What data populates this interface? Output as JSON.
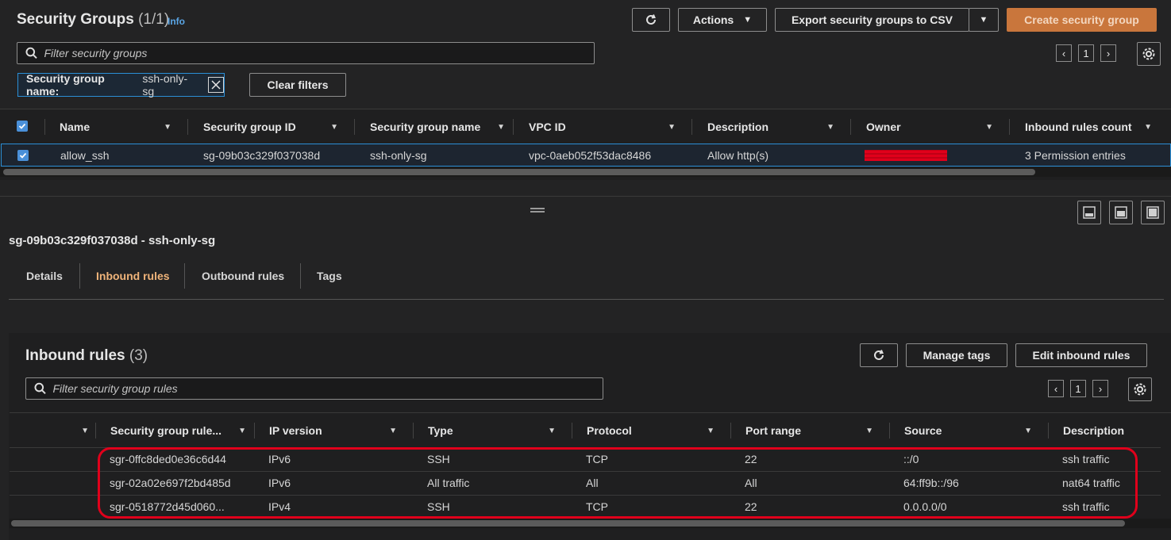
{
  "sg_panel": {
    "title": "Security Groups",
    "count": "(1/1)",
    "info": "Info",
    "actions": "Actions",
    "export": "Export security groups to CSV",
    "create": "Create security group",
    "filter_placeholder": "Filter security groups",
    "chip_label": "Security group name:",
    "chip_value": "ssh-only-sg",
    "clear_filters": "Clear filters",
    "page": "1",
    "columns": [
      "Name",
      "Security group ID",
      "Security group name",
      "VPC ID",
      "Description",
      "Owner",
      "Inbound rules count"
    ],
    "row": {
      "name": "allow_ssh",
      "id": "sg-09b03c329f037038d",
      "group_name": "ssh-only-sg",
      "vpc": "vpc-0aeb052f53dac8486",
      "description": "Allow http(s)",
      "owner": "",
      "rules_count": "3 Permission entries"
    }
  },
  "detail": {
    "heading": "sg-09b03c329f037038d - ssh-only-sg",
    "tabs": [
      "Details",
      "Inbound rules",
      "Outbound rules",
      "Tags"
    ],
    "active_tab": "Inbound rules"
  },
  "inbound": {
    "title": "Inbound rules",
    "count": "(3)",
    "manage_tags": "Manage tags",
    "edit": "Edit inbound rules",
    "filter_placeholder": "Filter security group rules",
    "page": "1",
    "columns": [
      "Security group rule...",
      "IP version",
      "Type",
      "Protocol",
      "Port range",
      "Source",
      "Description"
    ],
    "rows": [
      [
        "sgr-0ffc8ded0e36c6d44",
        "IPv6",
        "SSH",
        "TCP",
        "22",
        "::/0",
        "ssh traffic"
      ],
      [
        "sgr-02a02e697f2bd485d",
        "IPv6",
        "All traffic",
        "All",
        "All",
        "64:ff9b::/96",
        "nat64 traffic"
      ],
      [
        "sgr-0518772d45d060...",
        "IPv4",
        "SSH",
        "TCP",
        "22",
        "0.0.0.0/0",
        "ssh traffic"
      ]
    ]
  },
  "colors": {
    "accent": "#c9763c",
    "link": "#5aa6e6",
    "active_tab": "#f0b47a",
    "selection_border": "#2b8fd6",
    "highlight": "#e0001b"
  }
}
